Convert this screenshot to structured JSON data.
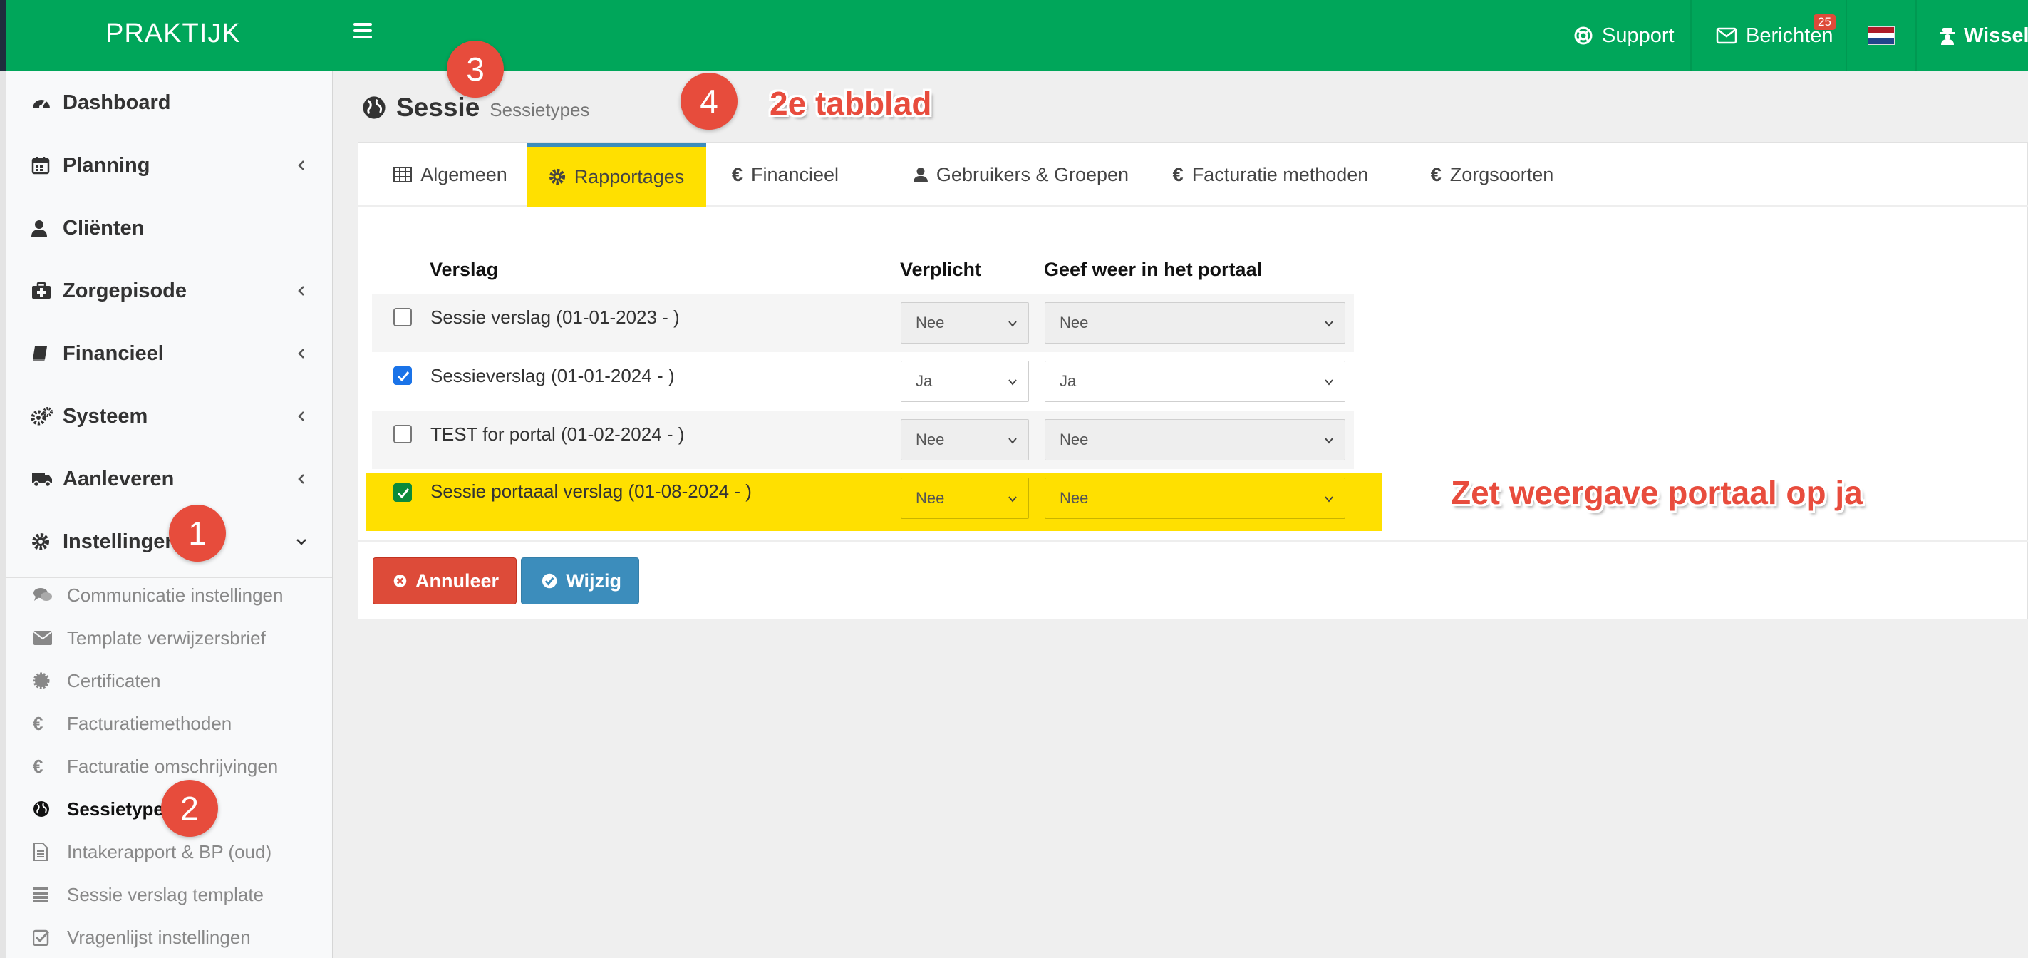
{
  "app": {
    "logo": "PRAKTIJK"
  },
  "topnav": {
    "support_label": "Support",
    "messages_label": "Berichten",
    "messages_badge": "25",
    "user_label": "Wissel"
  },
  "sidebar": {
    "items": [
      {
        "label": "Dashboard",
        "icon": "dashboard-icon"
      },
      {
        "label": "Planning",
        "icon": "calendar-icon"
      },
      {
        "label": "Cliënten",
        "icon": "user-icon"
      },
      {
        "label": "Zorgepisode",
        "icon": "medkit-icon"
      },
      {
        "label": "Financieel",
        "icon": "book-icon"
      },
      {
        "label": "Systeem",
        "icon": "gears-icon"
      },
      {
        "label": "Aanleveren",
        "icon": "truck-icon"
      },
      {
        "label": "Instellingen",
        "icon": "gear-icon"
      }
    ],
    "subitems": [
      {
        "label": "Communicatie instellingen",
        "icon": "comments-icon"
      },
      {
        "label": "Template verwijzersbrief",
        "icon": "envelope-icon"
      },
      {
        "label": "Certificaten",
        "icon": "certificate-icon"
      },
      {
        "label": "Facturatiemethoden",
        "icon": "euro-icon"
      },
      {
        "label": "Facturatie omschrijvingen",
        "icon": "euro-icon"
      },
      {
        "label": "Sessietypes",
        "icon": "globe-icon"
      },
      {
        "label": "Intakerapport & BP (oud)",
        "icon": "file-icon"
      },
      {
        "label": "Sessie verslag template",
        "icon": "list-icon"
      },
      {
        "label": "Vragenlijst instellingen",
        "icon": "checkbox-icon"
      }
    ]
  },
  "page": {
    "title": "Sessie",
    "subtitle": "Sessietypes"
  },
  "tabs": [
    {
      "label": "Algemeen"
    },
    {
      "label": "Rapportages"
    },
    {
      "label": "Financieel"
    },
    {
      "label": "Gebruikers & Groepen"
    },
    {
      "label": "Facturatie methoden"
    },
    {
      "label": "Zorgsoorten"
    }
  ],
  "table": {
    "headers": [
      "Verslag",
      "Verplicht",
      "Geef weer in het portaal"
    ],
    "rows": [
      {
        "label": "Sessie verslag (01-01-2023 - )",
        "checked": false,
        "verplicht": "Nee",
        "portaal": "Nee"
      },
      {
        "label": "Sessieverslag (01-01-2024 - )",
        "checked": true,
        "verplicht": "Ja",
        "portaal": "Ja"
      },
      {
        "label": "TEST for portal (01-02-2024 - )",
        "checked": false,
        "verplicht": "Nee",
        "portaal": "Nee"
      },
      {
        "label": "Sessie portaaal verslag (01-08-2024 - )",
        "checked": true,
        "verplicht": "Nee",
        "portaal": "Nee"
      }
    ]
  },
  "buttons": {
    "cancel": "Annuleer",
    "save": "Wijzig"
  },
  "annotations": {
    "markers": [
      "1",
      "2",
      "3",
      "4"
    ],
    "tab_note": "2e tabblad",
    "portal_note": "Zet weergave portaal op ja"
  },
  "colors": {
    "topbar": "#00a65a",
    "highlight": "#ffe000",
    "danger": "#dd4b39",
    "primary": "#3c8dbc",
    "marker": "#e74c3c"
  }
}
